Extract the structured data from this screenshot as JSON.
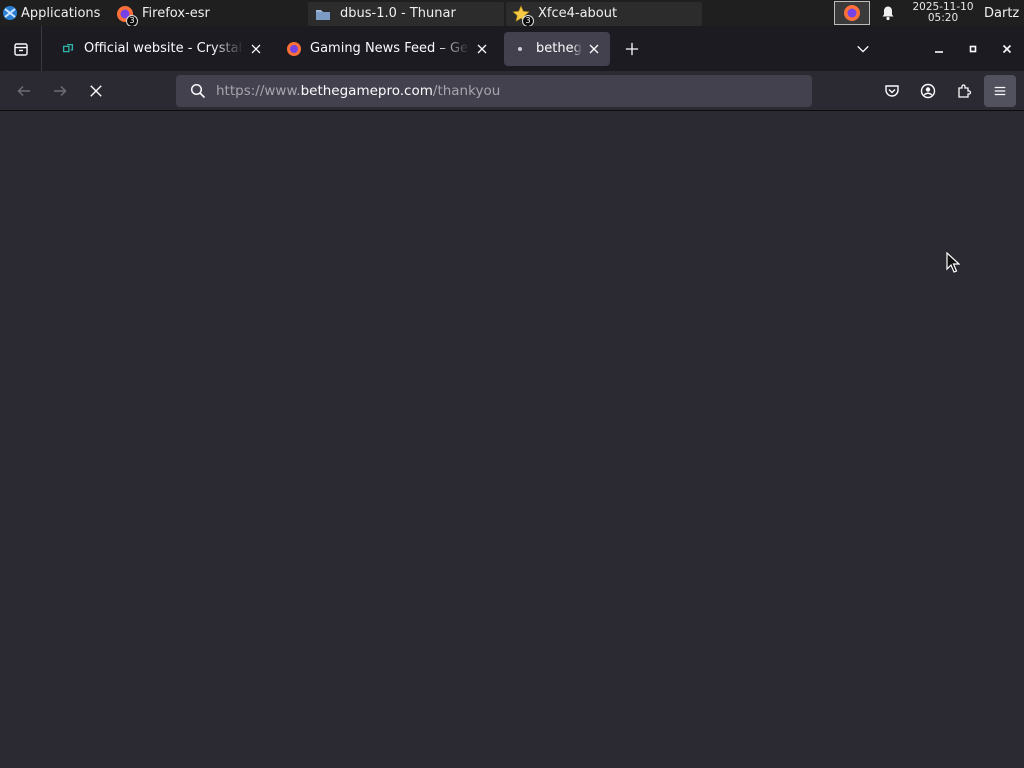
{
  "panel": {
    "apps_label": "Applications",
    "tasks": [
      {
        "label": "Firefox-esr",
        "badge": "3",
        "icon": "firefox-icon",
        "active": true
      },
      {
        "label": "dbus-1.0 - Thunar",
        "badge": "",
        "icon": "folder-icon",
        "active": false
      },
      {
        "label": "Xfce4-about",
        "badge": "3",
        "icon": "star-icon",
        "active": false
      }
    ],
    "clock_date": "2025-11-10",
    "clock_time": "05:20",
    "user": "Dartz"
  },
  "browser": {
    "tabs": [
      {
        "title": "Official website - Crystal",
        "icon": "crystal-favicon",
        "selected": false
      },
      {
        "title": "Gaming News Feed – Get",
        "icon": "firefox-favicon",
        "selected": false
      },
      {
        "title": "bethegamepro.com",
        "icon": "loading-dot",
        "selected": true
      }
    ],
    "url_prefix": "https://www.",
    "url_domain": "bethegamepro.com",
    "url_path": "/thankyou"
  },
  "colors": {
    "panel_bg": "#1f1f1f",
    "tabstrip_bg": "#1c1b22",
    "toolbar_bg": "#2b2a33",
    "urlbar_bg": "#42414d",
    "content_bg": "#2b2a33"
  }
}
